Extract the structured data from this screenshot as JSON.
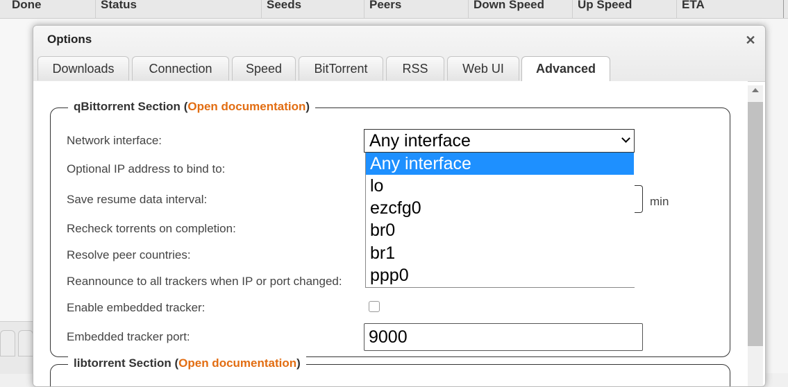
{
  "background_table": {
    "columns": [
      "Done",
      "Status",
      "Seeds",
      "Peers",
      "Down Speed",
      "Up Speed",
      "ETA"
    ]
  },
  "dialog": {
    "title": "Options",
    "close_icon": "close-icon",
    "tabs": [
      {
        "label": "Downloads",
        "active": false
      },
      {
        "label": "Connection",
        "active": false
      },
      {
        "label": "Speed",
        "active": false
      },
      {
        "label": "BitTorrent",
        "active": false
      },
      {
        "label": "RSS",
        "active": false
      },
      {
        "label": "Web UI",
        "active": false
      },
      {
        "label": "Advanced",
        "active": true
      }
    ],
    "sections": [
      {
        "title": "qBittorrent Section",
        "open_paren": "(",
        "link": "Open documentation",
        "close_paren": ")",
        "rows": [
          {
            "label": "Network interface:"
          },
          {
            "label": "Optional IP address to bind to:"
          },
          {
            "label": "Save resume data interval:",
            "unit": "min"
          },
          {
            "label": "Recheck torrents on completion:"
          },
          {
            "label": "Resolve peer countries:"
          },
          {
            "label": "Reannounce to all trackers when IP or port changed:"
          },
          {
            "label": "Enable embedded tracker:",
            "checked": false
          },
          {
            "label": "Embedded tracker port:",
            "value": "9000"
          }
        ]
      },
      {
        "title": "libtorrent Section",
        "open_paren": "(",
        "link": "Open documentation",
        "close_paren": ")"
      }
    ],
    "network_interface": {
      "selected": "Any interface",
      "options": [
        "Any interface",
        "lo",
        "ezcfg0",
        "br0",
        "br1",
        "ppp0"
      ]
    }
  },
  "colors": {
    "link": "#e26d12",
    "selected_option": "#1e90ff"
  }
}
